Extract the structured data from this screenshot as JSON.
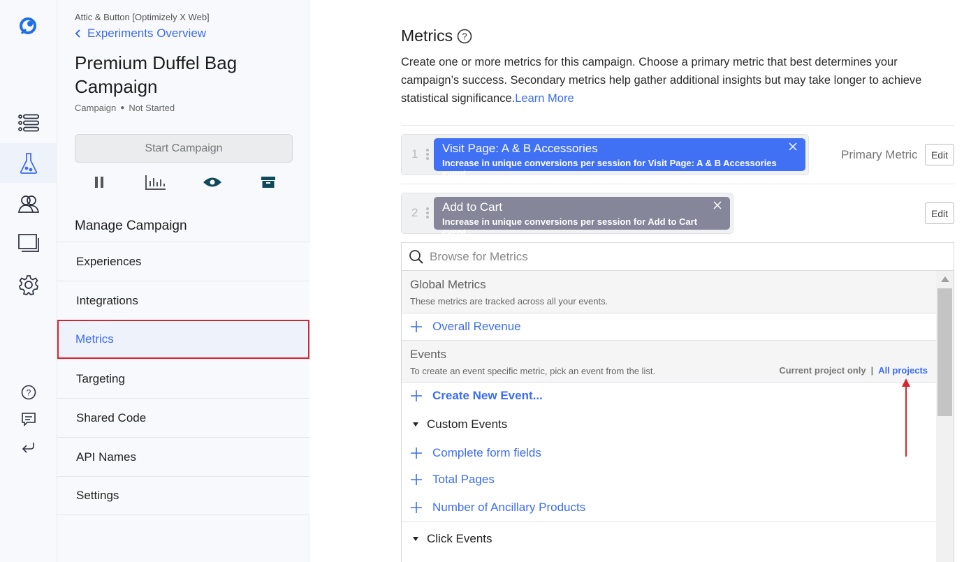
{
  "rail": {
    "icons": [
      "logo-icon",
      "list-icon",
      "flask-icon",
      "users-icon",
      "windows-icon",
      "gear-icon",
      "help-icon",
      "feedback-icon",
      "return-icon"
    ]
  },
  "sidebar": {
    "project": "Attic & Button [Optimizely X Web]",
    "back_label": "Experiments Overview",
    "title": "Premium Duffel Bag Campaign",
    "type": "Campaign",
    "status": "Not Started",
    "start_button": "Start Campaign",
    "manage_heading": "Manage Campaign",
    "menu": [
      {
        "label": "Experiences"
      },
      {
        "label": "Integrations"
      },
      {
        "label": "Metrics"
      },
      {
        "label": "Targeting"
      },
      {
        "label": "Shared Code"
      },
      {
        "label": "API Names"
      },
      {
        "label": "Settings"
      }
    ]
  },
  "main": {
    "heading": "Metrics",
    "description": "Create one or more metrics for this campaign. Choose a primary metric that best determines your campaign’s success. Secondary metrics help gather additional insights but may take longer to achieve statistical significance.",
    "learn_more": "Learn More",
    "metrics": [
      {
        "index": "1",
        "title": "Visit Page: A & B Accessories",
        "subtitle": "Increase in unique conversions per session for Visit Page: A & B Accessories event",
        "color": "#4070f4"
      },
      {
        "index": "2",
        "title": "Add to Cart",
        "subtitle": "Increase in unique conversions per session for Add to Cart event",
        "color": "#85869a"
      }
    ],
    "primary_label": "Primary Metric",
    "edit_label": "Edit",
    "search_placeholder": "Browse for Metrics",
    "global": {
      "title": "Global Metrics",
      "desc": "These metrics are tracked across all your events.",
      "items": [
        "Overall Revenue"
      ]
    },
    "events": {
      "title": "Events",
      "desc": "To create an event specific metric, pick an event from the list.",
      "current_only": "Current project only",
      "separator": "|",
      "all_projects": "All projects",
      "create": "Create New Event...",
      "custom_group": "Custom Events",
      "custom_items": [
        "Complete form fields",
        "Total Pages",
        "Number of Ancillary Products"
      ],
      "click_group": "Click Events"
    },
    "accent": "#3c6df0",
    "highlight": "#d9242f"
  }
}
